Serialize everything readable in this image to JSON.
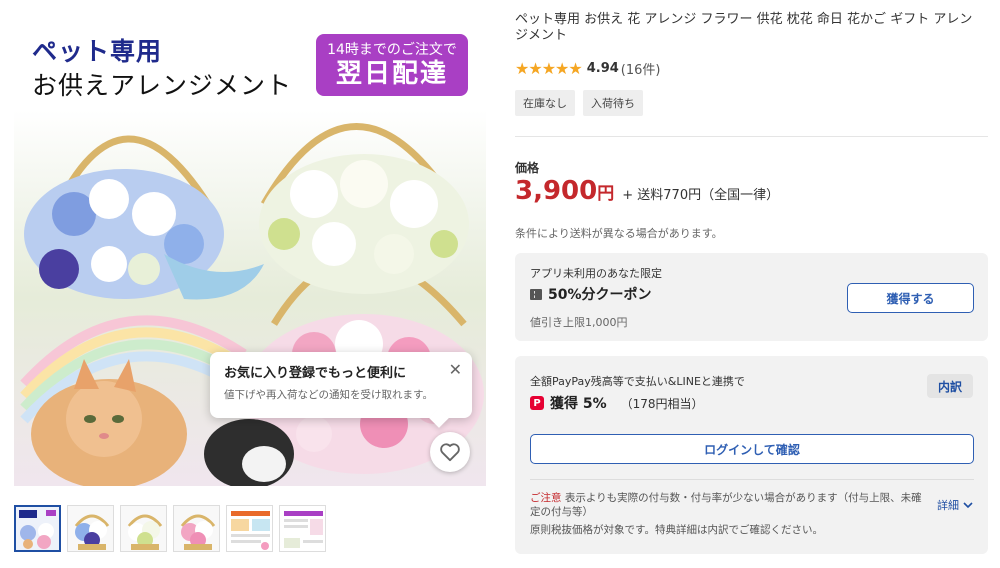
{
  "product": {
    "title": "ペット専用 お供え 花 アレンジ フラワー 供花 枕花 命日 花かご ギフト アレンジメント",
    "rating": {
      "stars": "★★★★★",
      "score": "4.94",
      "count": "(16件)"
    },
    "tags": [
      "在庫なし",
      "入荷待ち"
    ]
  },
  "image": {
    "title_line1": "ペット専用",
    "title_line2": "お供えアレンジメント",
    "badge_line1": "14時までのご注文で",
    "badge_line2": "翌日配達"
  },
  "favorite_popup": {
    "title": "お気に入り登録でもっと便利に",
    "subtitle": "値下げや再入荷などの通知を受け取れます。"
  },
  "thumbnails": [
    {
      "label": "thumb-1"
    },
    {
      "label": "thumb-2"
    },
    {
      "label": "thumb-3"
    },
    {
      "label": "thumb-4"
    },
    {
      "label": "thumb-5"
    },
    {
      "label": "thumb-6"
    }
  ],
  "price": {
    "label": "価格",
    "value": "3,900",
    "unit": "円",
    "shipping": "+ 送料770円（全国一律）",
    "shipping_note": "条件により送料が異なる場合があります。"
  },
  "coupon": {
    "line1": "アプリ未利用のあなた限定",
    "title": "50%分クーポン",
    "limit": "値引き上限1,000円",
    "button": "獲得する"
  },
  "paypay": {
    "line1": "全額PayPay残高等で支払い&LINEと連携で",
    "icon_text": "P",
    "earn": "獲得 5%",
    "earn_sub": "（178円相当）",
    "breakdown_button": "内訳",
    "login_button": "ログインして確認",
    "caution_label": "ご注意",
    "caution_text": "表示よりも実際の付与数・付与率が少ない場合があります（付与上限、未確定の付与等）",
    "detail_link": "詳細",
    "note": "原則税抜価格が対象です。特典詳細は内訳でご確認ください。"
  },
  "colors": {
    "price_red": "#c4282c",
    "link_blue": "#2f5fb3",
    "star": "#f5a623",
    "badge_purple": "#a93fc4",
    "paypay_red": "#e60033"
  }
}
